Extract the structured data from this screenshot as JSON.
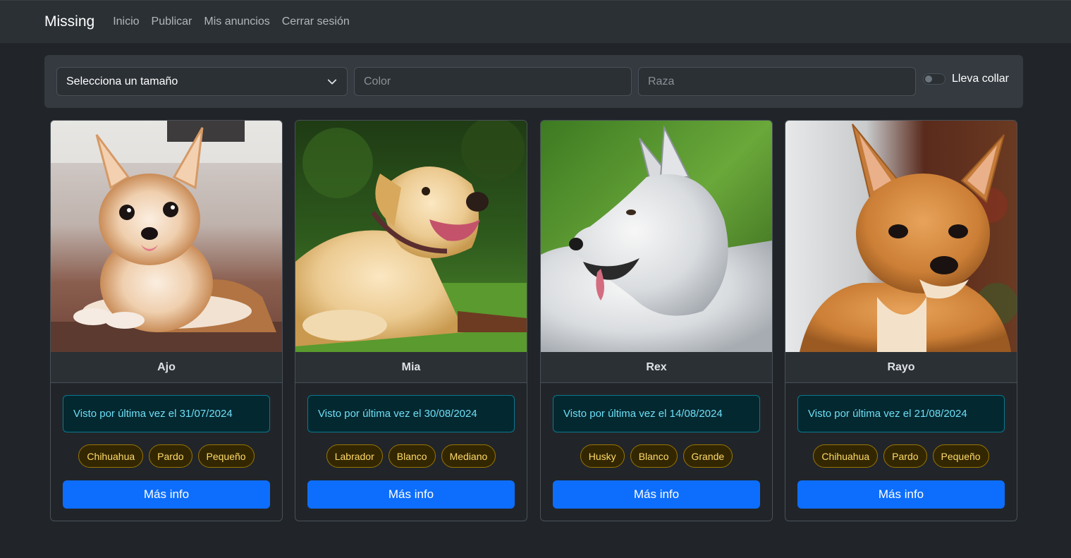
{
  "navbar": {
    "brand": "Missing",
    "links": [
      "Inicio",
      "Publicar",
      "Mis anuncios",
      "Cerrar sesión"
    ]
  },
  "filters": {
    "size_select_value": "Selecciona un tamaño",
    "color_placeholder": "Color",
    "breed_placeholder": "Raza",
    "collar_label": "Lleva collar",
    "collar_checked": false
  },
  "cards": [
    {
      "name": "Ajo",
      "seen": "Visto por última vez el 31/07/2024",
      "tags": [
        "Chihuahua",
        "Pardo",
        "Pequeño"
      ],
      "button": "Más info",
      "image": "chihuahua-long-hair-photo"
    },
    {
      "name": "Mia",
      "seen": "Visto por última vez el 30/08/2024",
      "tags": [
        "Labrador",
        "Blanco",
        "Mediano"
      ],
      "button": "Más info",
      "image": "labrador-photo"
    },
    {
      "name": "Rex",
      "seen": "Visto por última vez el 14/08/2024",
      "tags": [
        "Husky",
        "Blanco",
        "Grande"
      ],
      "button": "Más info",
      "image": "husky-photo"
    },
    {
      "name": "Rayo",
      "seen": "Visto por última vez el 21/08/2024",
      "tags": [
        "Chihuahua",
        "Pardo",
        "Pequeño"
      ],
      "button": "Más info",
      "image": "chihuahua-short-hair-photo"
    }
  ],
  "colors": {
    "page_bg": "#212529",
    "navbar_bg": "#2b3035",
    "primary": "#0d6efd",
    "info_text": "#6edff6",
    "warning_text": "#ffda6a"
  }
}
